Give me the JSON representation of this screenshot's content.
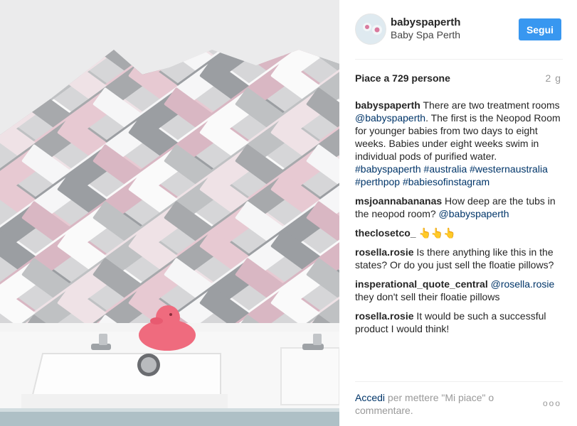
{
  "post": {
    "image_alt": "Pink rubber duck on a sink in front of herringbone tiled wall",
    "username": "babyspaperth",
    "full_name": "Baby Spa Perth",
    "follow_label": "Segui",
    "likes_text": "Piace a 729 persone",
    "time_ago": "2 g"
  },
  "caption": {
    "user": "babyspaperth",
    "t1": "There are two treatment rooms",
    "m1": "@babyspaperth",
    "t2": ". The first is the Neopod Room for younger babies from two days to eight weeks. Babies under eight weeks swim in individual pods of purified water.",
    "h1": "#babyspaperth",
    "h2": "#australia",
    "h3": "#westernaustralia",
    "h4": "#perthpop",
    "h5": "#babiesofinstagram"
  },
  "comments": [
    {
      "user": "msjoannabananas",
      "text": "How deep are the tubs in the neopod room?",
      "mention": "@babyspaperth"
    },
    {
      "user": "theclosetco_",
      "text": "👆👆👆"
    },
    {
      "user": "rosella.rosie",
      "text": "Is there anything like this in the states? Or do you just sell the floatie pillows?"
    },
    {
      "user": "insperational_quote_central",
      "mention": "@rosella.rosie",
      "text": "they don't sell their floatie pillows"
    },
    {
      "user": "rosella.rosie",
      "text": "It would be such a successful product I would think!"
    }
  ],
  "footer": {
    "login_link": "Accedi",
    "login_text": "per mettere \"Mi piace\" o commentare.",
    "more_label": "ooo"
  },
  "colors": {
    "follow_button": "#3897f0",
    "link": "#003569",
    "duck": "#ef6b7e"
  }
}
